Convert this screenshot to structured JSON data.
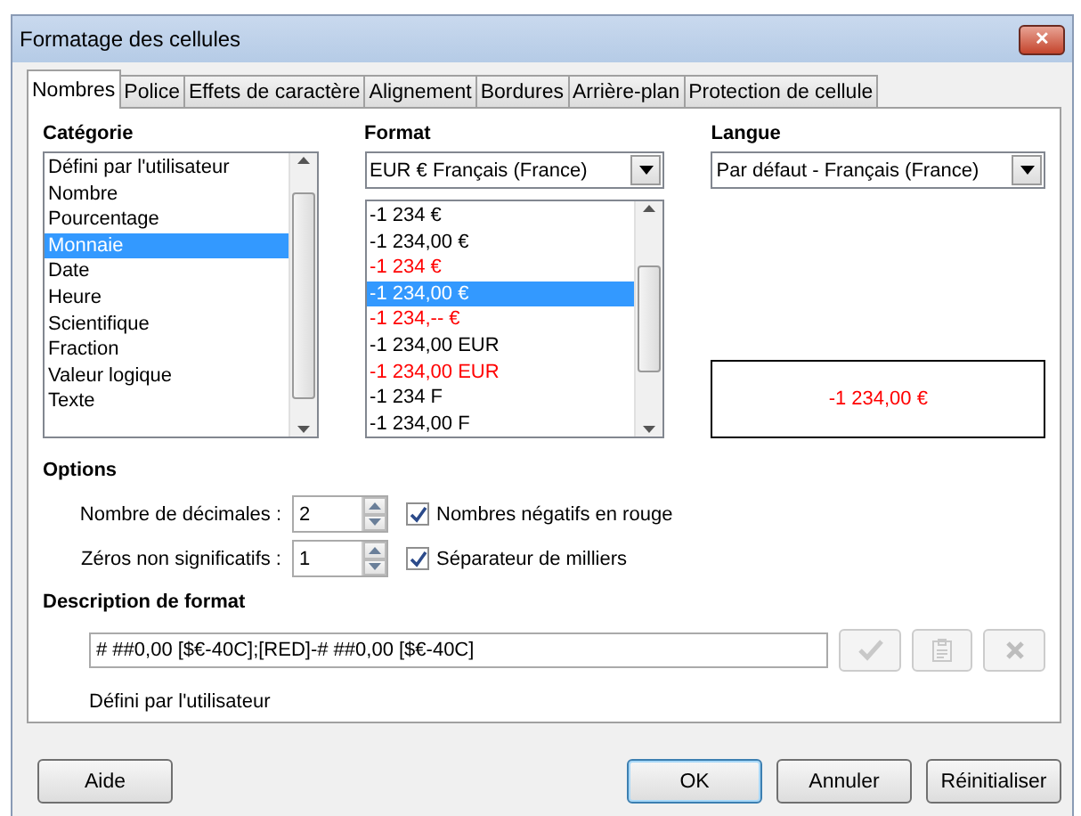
{
  "window": {
    "title": "Formatage des cellules",
    "close": "✕"
  },
  "tabs": [
    {
      "label": "Nombres",
      "selected": true
    },
    {
      "label": "Police",
      "selected": false
    },
    {
      "label": "Effets de caractère",
      "selected": false
    },
    {
      "label": "Alignement",
      "selected": false
    },
    {
      "label": "Bordures",
      "selected": false
    },
    {
      "label": "Arrière-plan",
      "selected": false
    },
    {
      "label": "Protection de cellule",
      "selected": false
    }
  ],
  "category": {
    "label": "Catégorie",
    "items": [
      {
        "label": "Défini par l'utilisateur",
        "selected": false
      },
      {
        "label": "Nombre",
        "selected": false
      },
      {
        "label": "Pourcentage",
        "selected": false
      },
      {
        "label": "Monnaie",
        "selected": true
      },
      {
        "label": "Date",
        "selected": false
      },
      {
        "label": "Heure",
        "selected": false
      },
      {
        "label": "Scientifique",
        "selected": false
      },
      {
        "label": "Fraction",
        "selected": false
      },
      {
        "label": "Valeur logique",
        "selected": false
      },
      {
        "label": "Texte",
        "selected": false
      }
    ]
  },
  "format": {
    "label": "Format",
    "currency": "EUR  €  Français (France)",
    "items": [
      {
        "label": "-1 234 €",
        "selected": false,
        "red": false
      },
      {
        "label": "-1 234,00 €",
        "selected": false,
        "red": false
      },
      {
        "label": "-1 234 €",
        "selected": false,
        "red": true
      },
      {
        "label": "-1 234,00 €",
        "selected": true,
        "red": false
      },
      {
        "label": "-1 234,-- €",
        "selected": false,
        "red": true
      },
      {
        "label": "-1 234,00 EUR",
        "selected": false,
        "red": false
      },
      {
        "label": "-1 234,00 EUR",
        "selected": false,
        "red": true
      },
      {
        "label": "-1 234 F",
        "selected": false,
        "red": false
      },
      {
        "label": "-1 234,00 F",
        "selected": false,
        "red": false
      }
    ]
  },
  "language": {
    "label": "Langue",
    "value": "Par défaut - Français (France)"
  },
  "preview": {
    "text": "-1 234,00 €",
    "color": "#ff0000"
  },
  "options": {
    "label": "Options",
    "decimals": {
      "label": "Nombre de décimales :",
      "value": "2"
    },
    "leading_zeros": {
      "label": "Zéros non significatifs :",
      "value": "1"
    },
    "negative_red": {
      "label": "Nombres négatifs en rouge",
      "checked": true
    },
    "thousands_separator": {
      "label": "Séparateur de milliers",
      "checked": true
    }
  },
  "format_code": {
    "label": "Description de format",
    "value": "# ##0,00 [$€-40C];[RED]-# ##0,00 [$€-40C]",
    "comment": "Défini par l'utilisateur"
  },
  "buttons": [
    {
      "label": "Aide",
      "kind": "help"
    },
    {
      "label": "OK",
      "kind": "default"
    },
    {
      "label": "Annuler",
      "kind": "normal"
    },
    {
      "label": "Réinitialiser",
      "kind": "normal"
    }
  ]
}
